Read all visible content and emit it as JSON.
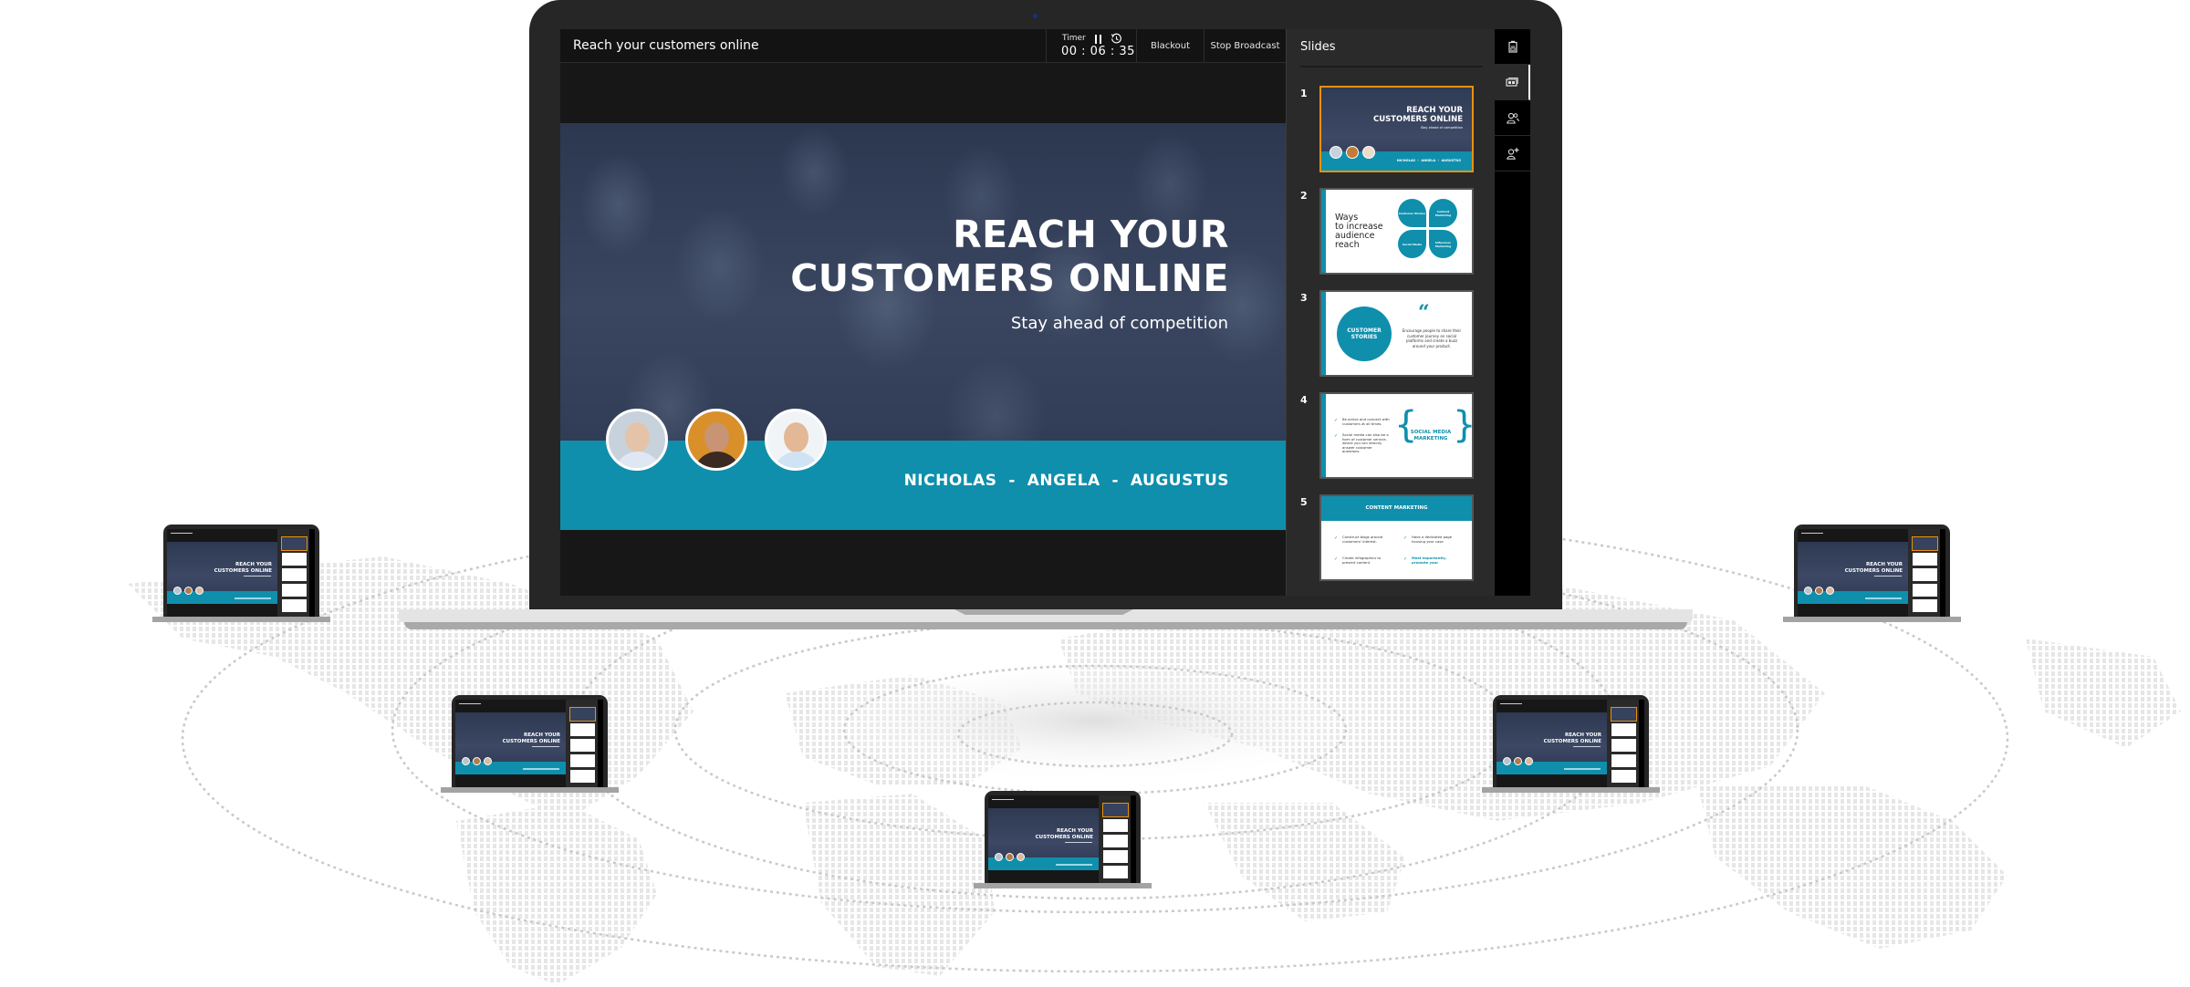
{
  "app": {
    "presentation_title": "Reach your customers online",
    "timer": {
      "label": "Timer",
      "value": "00 : 06 : 35",
      "pause_icon": "pause-icon",
      "reset_icon": "history-icon"
    },
    "buttons": {
      "blackout": "Blackout",
      "stop_broadcast": "Stop Broadcast"
    }
  },
  "current_slide": {
    "title_line1": "REACH YOUR",
    "title_line2": "CUSTOMERS ONLINE",
    "subtitle": "Stay ahead of competition",
    "presenters": "NICHOLAS  -  ANGELA  -  AUGUSTUS",
    "presenter_avatars": [
      "Nicholas",
      "Angela",
      "Augustus"
    ]
  },
  "slides_panel": {
    "heading": "Slides",
    "slides": [
      {
        "number": "1",
        "active": true,
        "title_line1": "REACH YOUR",
        "title_line2": "CUSTOMERS ONLINE",
        "subtitle": "Stay ahead of competition",
        "names": "NICHOLAS  -  ANGELA  -  AUGUSTUS"
      },
      {
        "number": "2",
        "title": "Ways to increase audience reach",
        "title_lines": [
          "Ways",
          "to increase",
          "audience",
          "reach"
        ],
        "petals": [
          "Customer Stories",
          "Content Marketing",
          "Social Media",
          "Influencer Marketing"
        ]
      },
      {
        "number": "3",
        "circle_label": "CUSTOMER STORIES",
        "quote_mark": "“",
        "body": "Encourage people to share their customer journey on social platforms and create a buzz around your product."
      },
      {
        "number": "4",
        "bullets": [
          "Be active and connect with customers at all times.",
          "Social media can also be a form of customer service, where you can directly answer customer questions."
        ],
        "label": "SOCIAL MEDIA MARKETING"
      },
      {
        "number": "5",
        "header": "CONTENT MARKETING",
        "bullets": [
          "Construct blogs around customers' interest.",
          "Have a dedicated page housing your case",
          "Create infographics to present content",
          "Most importantly, promote your"
        ]
      }
    ]
  },
  "side_icons": [
    {
      "name": "notes-icon",
      "active": false
    },
    {
      "name": "slides-icon",
      "active": true
    },
    {
      "name": "audience-icon",
      "active": false
    },
    {
      "name": "add-user-icon",
      "active": false
    }
  ],
  "mini_screens": {
    "title_line1": "REACH YOUR",
    "title_line2": "CUSTOMERS ONLINE"
  },
  "colors": {
    "accent_teal": "#0f8fac",
    "active_slide_border": "#e8910f",
    "app_background": "#171717",
    "panel_background": "#2a2a2a"
  }
}
